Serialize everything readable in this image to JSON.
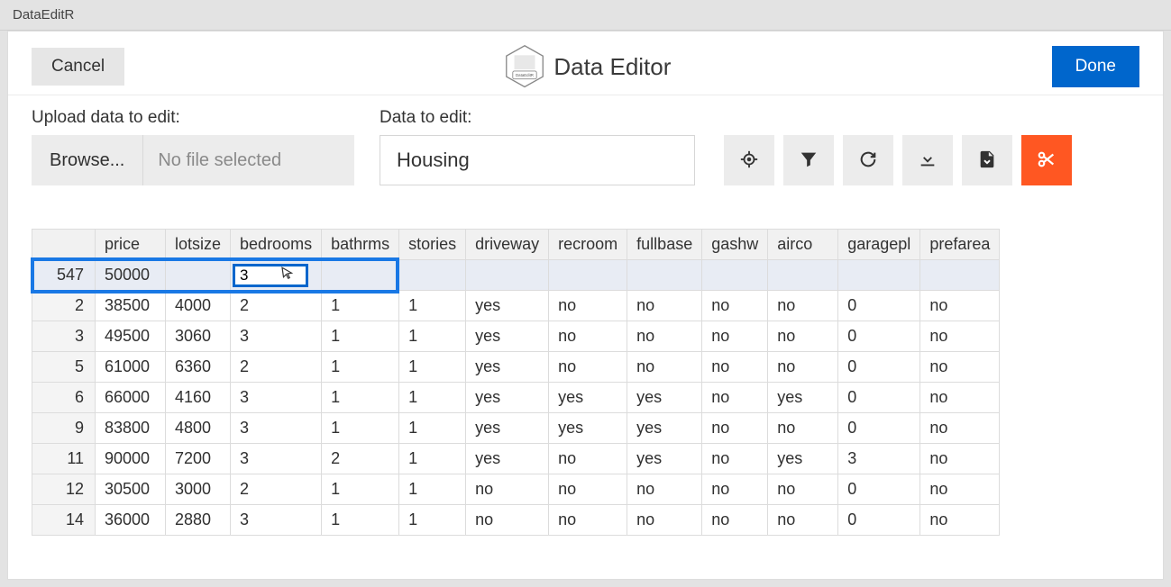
{
  "window_title": "DataEditR",
  "header": {
    "cancel_label": "Cancel",
    "app_title": "Data Editor",
    "logo_text": "DataEditR",
    "done_label": "Done"
  },
  "upload": {
    "label": "Upload data to edit:",
    "browse_label": "Browse...",
    "file_status": "No file selected"
  },
  "data_select": {
    "label": "Data to edit:",
    "value": "Housing"
  },
  "icons": {
    "target": "target",
    "filter": "filter",
    "refresh": "refresh",
    "download": "download",
    "save": "save",
    "cut": "cut"
  },
  "table": {
    "columns": [
      "price",
      "lotsize",
      "bedrooms",
      "bathrms",
      "stories",
      "driveway",
      "recroom",
      "fullbase",
      "gashw",
      "airco",
      "garagepl",
      "prefarea"
    ],
    "active_row": {
      "rownum": "547",
      "price": "50000",
      "lotsize": "",
      "bedrooms_editing": "3",
      "bathrms": "",
      "rest_empty": true
    },
    "rows": [
      {
        "rownum": "2",
        "price": "38500",
        "lotsize": "4000",
        "bedrooms": "2",
        "bathrms": "1",
        "stories": "1",
        "driveway": "yes",
        "recroom": "no",
        "fullbase": "no",
        "gashw": "no",
        "airco": "no",
        "garagepl": "0",
        "prefarea": "no"
      },
      {
        "rownum": "3",
        "price": "49500",
        "lotsize": "3060",
        "bedrooms": "3",
        "bathrms": "1",
        "stories": "1",
        "driveway": "yes",
        "recroom": "no",
        "fullbase": "no",
        "gashw": "no",
        "airco": "no",
        "garagepl": "0",
        "prefarea": "no"
      },
      {
        "rownum": "5",
        "price": "61000",
        "lotsize": "6360",
        "bedrooms": "2",
        "bathrms": "1",
        "stories": "1",
        "driveway": "yes",
        "recroom": "no",
        "fullbase": "no",
        "gashw": "no",
        "airco": "no",
        "garagepl": "0",
        "prefarea": "no"
      },
      {
        "rownum": "6",
        "price": "66000",
        "lotsize": "4160",
        "bedrooms": "3",
        "bathrms": "1",
        "stories": "1",
        "driveway": "yes",
        "recroom": "yes",
        "fullbase": "yes",
        "gashw": "no",
        "airco": "yes",
        "garagepl": "0",
        "prefarea": "no"
      },
      {
        "rownum": "9",
        "price": "83800",
        "lotsize": "4800",
        "bedrooms": "3",
        "bathrms": "1",
        "stories": "1",
        "driveway": "yes",
        "recroom": "yes",
        "fullbase": "yes",
        "gashw": "no",
        "airco": "no",
        "garagepl": "0",
        "prefarea": "no"
      },
      {
        "rownum": "11",
        "price": "90000",
        "lotsize": "7200",
        "bedrooms": "3",
        "bathrms": "2",
        "stories": "1",
        "driveway": "yes",
        "recroom": "no",
        "fullbase": "yes",
        "gashw": "no",
        "airco": "yes",
        "garagepl": "3",
        "prefarea": "no"
      },
      {
        "rownum": "12",
        "price": "30500",
        "lotsize": "3000",
        "bedrooms": "2",
        "bathrms": "1",
        "stories": "1",
        "driveway": "no",
        "recroom": "no",
        "fullbase": "no",
        "gashw": "no",
        "airco": "no",
        "garagepl": "0",
        "prefarea": "no"
      },
      {
        "rownum": "14",
        "price": "36000",
        "lotsize": "2880",
        "bedrooms": "3",
        "bathrms": "1",
        "stories": "1",
        "driveway": "no",
        "recroom": "no",
        "fullbase": "no",
        "gashw": "no",
        "airco": "no",
        "garagepl": "0",
        "prefarea": "no"
      }
    ]
  }
}
